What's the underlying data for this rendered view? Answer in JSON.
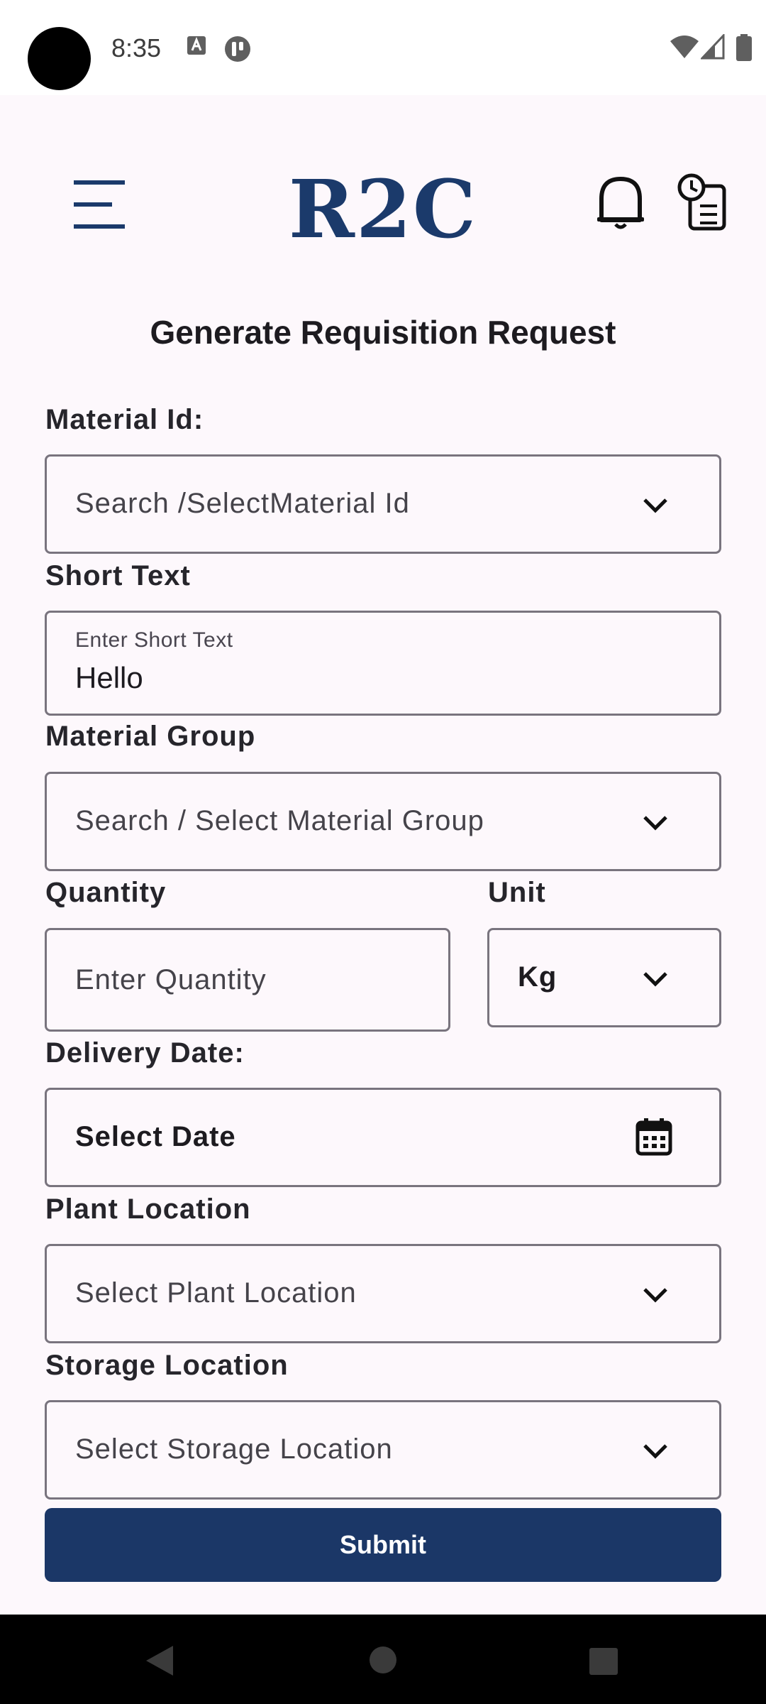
{
  "status_bar": {
    "time": "8:35",
    "icons": [
      "camera-cutout",
      "text-a-icon",
      "app-notification-icon",
      "wifi-icon",
      "signal-icon",
      "battery-icon"
    ]
  },
  "app_bar": {
    "logo": "R2C",
    "icons": [
      "menu-icon",
      "bell-icon",
      "history-icon"
    ]
  },
  "form": {
    "title": "Generate Requisition Request",
    "material_id": {
      "label": "Material Id:",
      "placeholder": "Search /SelectMaterial Id"
    },
    "short_text": {
      "label": "Short Text",
      "floating_label": "Enter Short Text",
      "value": "Hello"
    },
    "material_group": {
      "label": "Material Group",
      "placeholder": "Search / Select Material Group"
    },
    "quantity": {
      "label": "Quantity",
      "placeholder": "Enter Quantity"
    },
    "unit": {
      "label": "Unit",
      "value": "Kg"
    },
    "delivery_date": {
      "label": "Delivery Date:",
      "placeholder": "Select Date"
    },
    "plant_location": {
      "label": "Plant Location",
      "placeholder": "Select Plant Location"
    },
    "storage_location": {
      "label": "Storage Location",
      "placeholder": "Select Storage Location"
    },
    "submit_label": "Submit"
  },
  "colors": {
    "brand": "#1b3767",
    "background": "#fdf8fc",
    "border": "#79747e"
  }
}
